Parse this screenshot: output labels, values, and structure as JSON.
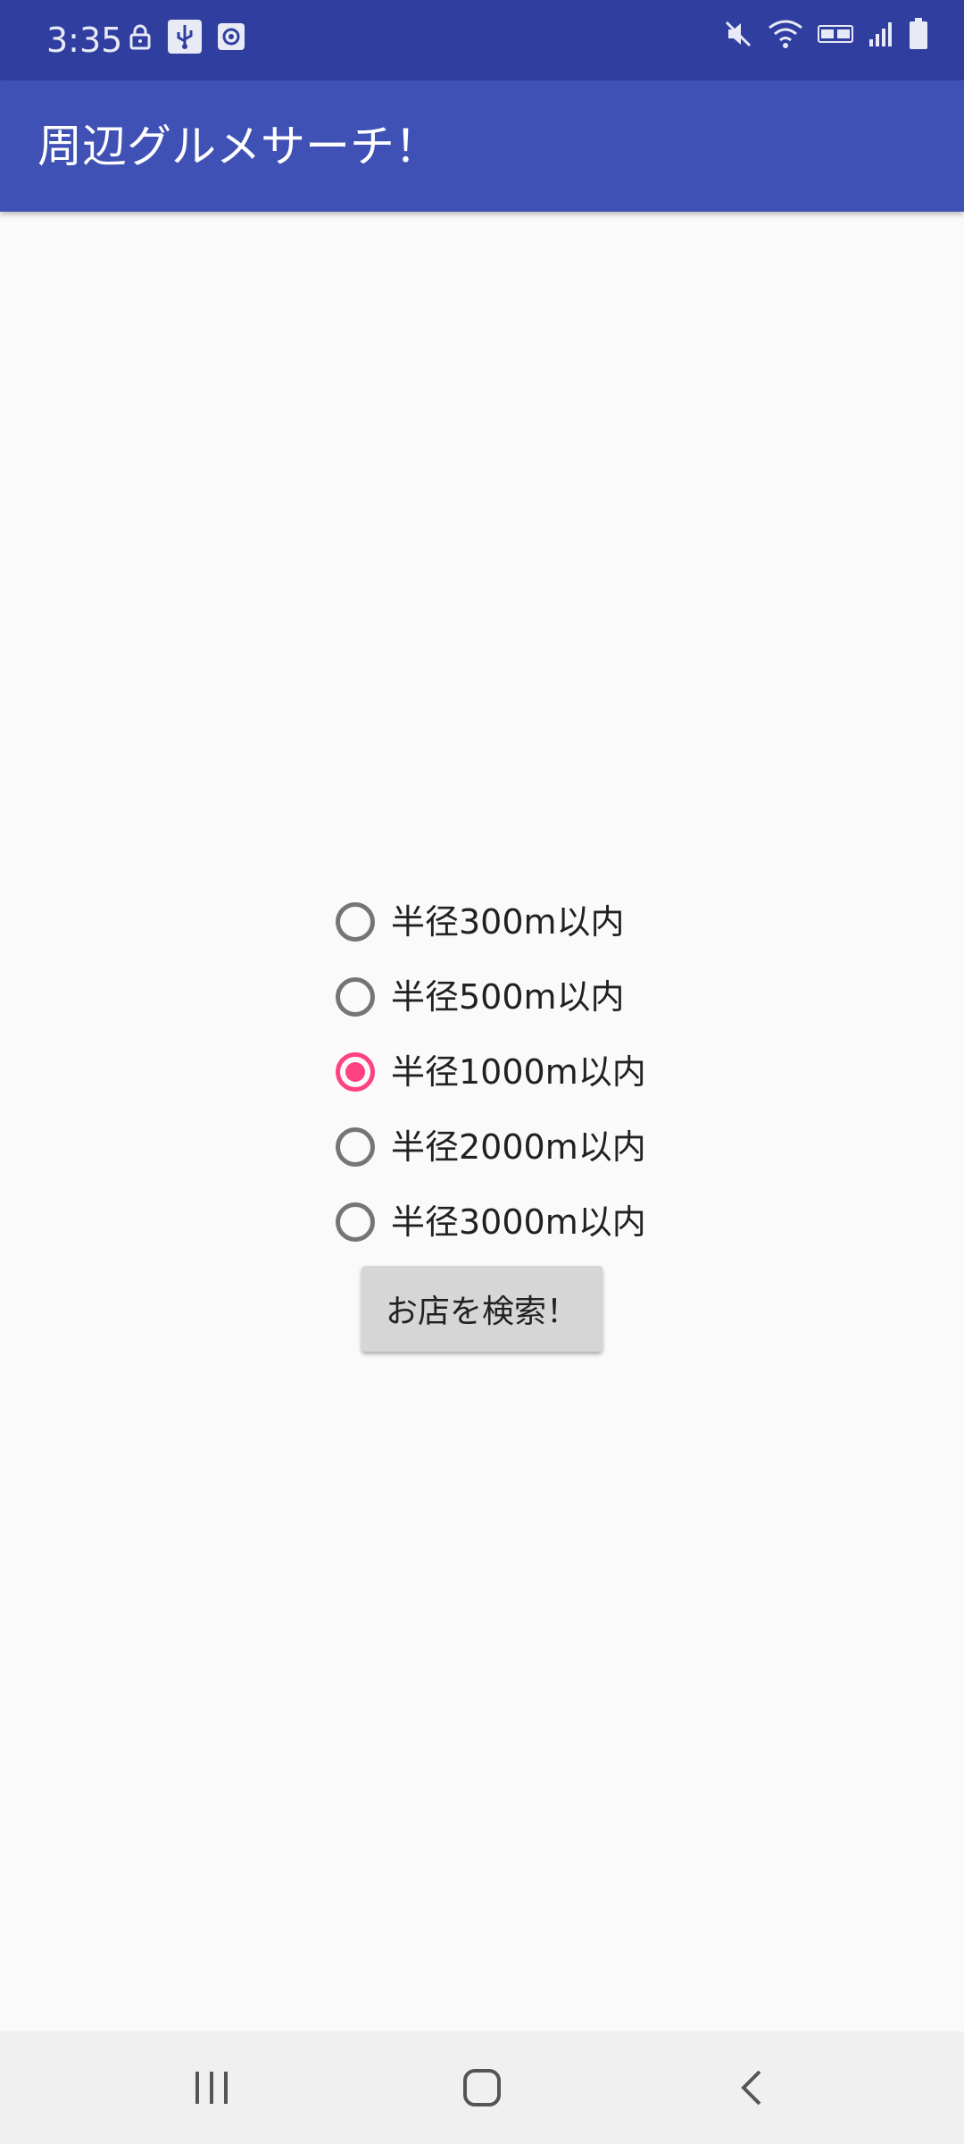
{
  "status_bar": {
    "time": "3:35",
    "left_icons": [
      "lock-icon",
      "usb-icon",
      "screen-recorder-icon"
    ],
    "right_icons": [
      "mute-icon",
      "wifi-icon",
      "volte-icon",
      "signal-icon",
      "battery-icon"
    ]
  },
  "app_bar": {
    "title": "周辺グルメサーチ！"
  },
  "radio_options": [
    {
      "label": "半径300m以内",
      "checked": false
    },
    {
      "label": "半径500m以内",
      "checked": false
    },
    {
      "label": "半径1000m以内",
      "checked": true
    },
    {
      "label": "半径2000m以内",
      "checked": false
    },
    {
      "label": "半径3000m以内",
      "checked": false
    }
  ],
  "search_button": {
    "label": "お店を検索！"
  },
  "nav_bar": {
    "buttons": [
      "recent-apps-icon",
      "home-icon",
      "back-icon"
    ]
  },
  "colors": {
    "status_bar": "#303f9f",
    "app_bar": "#3f51b5",
    "accent": "#ff4081",
    "background": "#fafafa"
  }
}
